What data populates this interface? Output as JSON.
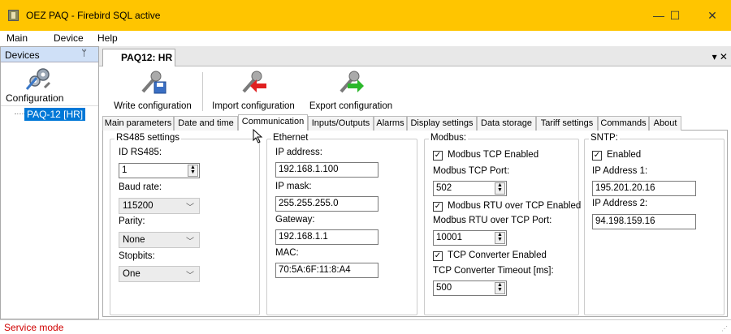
{
  "window": {
    "title": "OEZ PAQ - Firebird SQL active",
    "minimize_glyph": "—",
    "maximize_glyph": "☐",
    "close_glyph": "✕"
  },
  "menu": {
    "items": [
      "Main",
      "Device",
      "Help"
    ]
  },
  "left_panel": {
    "title": "Devices",
    "pin_glyph": "ᛘ",
    "config_label": "Configuration",
    "tree_item": "PAQ-12 [HR]"
  },
  "document": {
    "tab_label": "PAQ12: HR",
    "controls": "▾ ✕"
  },
  "toolbar": {
    "write_label": "Write configuration",
    "import_label": "Import configuration",
    "export_label": "Export configuration"
  },
  "tabs": [
    "Main parameters",
    "Date and time",
    "Communication",
    "Inputs/Outputs",
    "Alarms",
    "Display settings",
    "Data storage",
    "Tariff settings",
    "Commands",
    "About"
  ],
  "active_tab": "Communication",
  "rs485": {
    "title": "RS485 settings",
    "id_label": "ID RS485:",
    "id_value": "1",
    "baud_label": "Baud rate:",
    "baud_value": "115200",
    "parity_label": "Parity:",
    "parity_value": "None",
    "stopbits_label": "Stopbits:",
    "stopbits_value": "One"
  },
  "ethernet": {
    "title": "Ethernet",
    "ip_label": "IP address:",
    "ip_value": "192.168.1.100",
    "mask_label": "IP mask:",
    "mask_value": "255.255.255.0",
    "gateway_label": "Gateway:",
    "gateway_value": "192.168.1.1",
    "mac_label": "MAC:",
    "mac_value": "70:5A:6F:11:8:A4"
  },
  "modbus": {
    "title": "Modbus:",
    "tcp_enabled_label": "Modbus TCP Enabled",
    "tcp_enabled": true,
    "tcp_port_label": "Modbus TCP Port:",
    "tcp_port_value": "502",
    "rtu_enabled_label": "Modbus RTU over TCP Enabled",
    "rtu_enabled": true,
    "rtu_port_label": "Modbus RTU over TCP Port:",
    "rtu_port_value": "10001",
    "conv_enabled_label": "TCP Converter Enabled",
    "conv_enabled": true,
    "conv_timeout_label": "TCP Converter Timeout [ms]:",
    "conv_timeout_value": "500"
  },
  "sntp": {
    "title": "SNTP:",
    "enabled_label": "Enabled",
    "enabled": true,
    "ip1_label": "IP Address 1:",
    "ip1_value": "195.201.20.16",
    "ip2_label": "IP Address 2:",
    "ip2_value": "94.198.159.16"
  },
  "status": {
    "text": "Service mode",
    "color": "#d00000"
  },
  "colors": {
    "titlebar": "#ffc500",
    "selection": "#0078d7"
  },
  "glyphs": {
    "check": "✓",
    "spin_up": "▲",
    "spin_down": "▼",
    "combo_arrow": "﹀",
    "grip": "⋰"
  }
}
